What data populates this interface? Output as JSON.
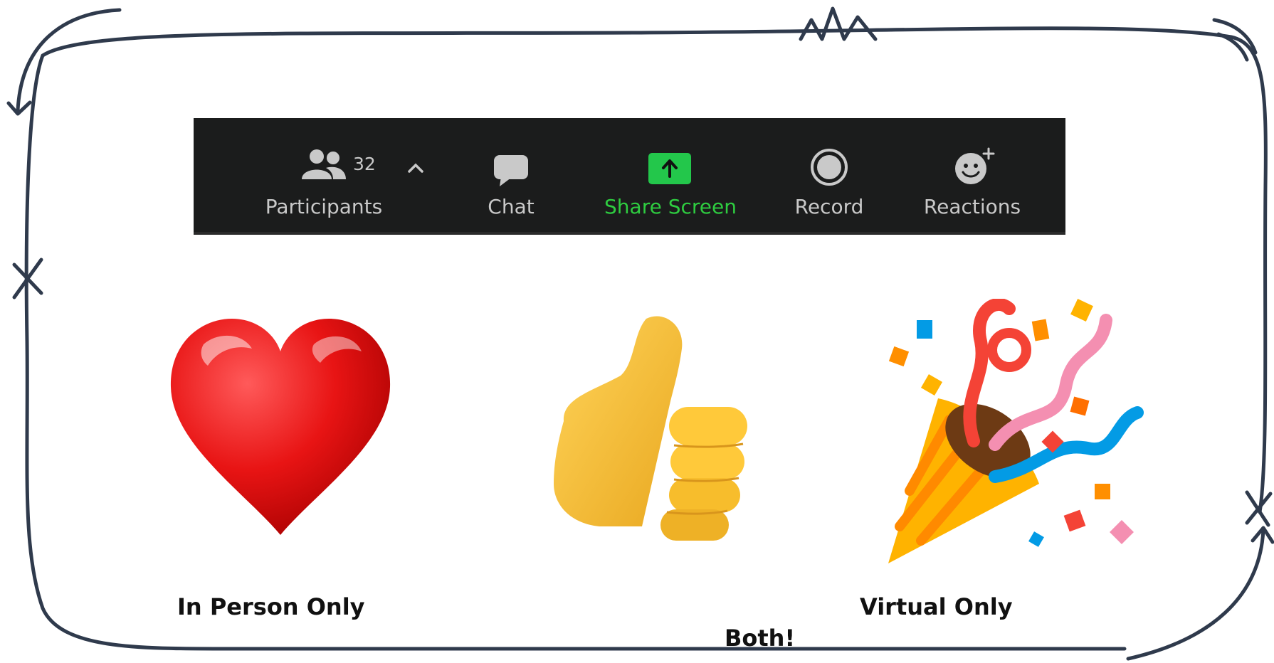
{
  "toolbar": {
    "participants_count": "32",
    "items": [
      {
        "label": "Participants",
        "icon": "participants-icon"
      },
      {
        "label": "Chat",
        "icon": "chat-icon"
      },
      {
        "label": "Share Screen",
        "icon": "share-screen-icon"
      },
      {
        "label": "Record",
        "icon": "record-icon"
      },
      {
        "label": "Reactions",
        "icon": "reactions-icon"
      }
    ],
    "colors": {
      "background": "#1b1c1c",
      "label": "#c9c9c9",
      "share": "#2ecc40",
      "highlight": "#ffff00"
    }
  },
  "reactions": [
    {
      "icon": "red-heart-emoji",
      "caption": "In Person Only"
    },
    {
      "icon": "thumbs-up-emoji",
      "caption": "Both!"
    },
    {
      "icon": "party-popper-emoji",
      "caption": "Virtual Only"
    }
  ]
}
